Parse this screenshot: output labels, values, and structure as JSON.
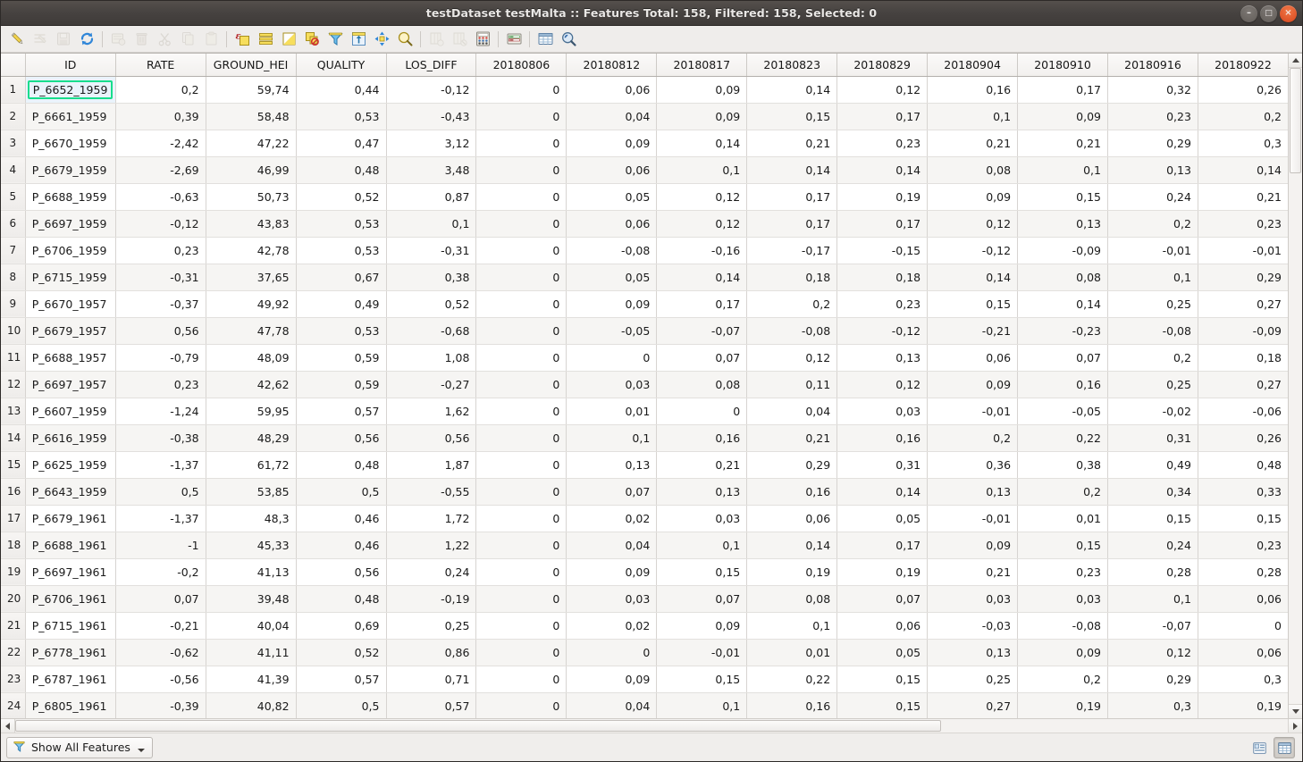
{
  "window": {
    "title": "testDataset testMalta :: Features Total: 158, Filtered: 158, Selected: 0",
    "minimize_label": "–",
    "maximize_label": "□",
    "close_label": "×"
  },
  "toolbar": {
    "items": [
      {
        "name": "toggle-editing-icon",
        "label": "Toggle editing mode",
        "enabled": true
      },
      {
        "name": "multi-edit-icon",
        "label": "Toggle multi edit mode",
        "enabled": false
      },
      {
        "name": "save-edits-icon",
        "label": "Save edits",
        "enabled": false
      },
      {
        "name": "reload-table-icon",
        "label": "Reload the table",
        "enabled": true
      },
      {
        "name": "add-feature-icon",
        "label": "Add feature",
        "enabled": false
      },
      {
        "name": "delete-selected-icon",
        "label": "Delete selected features",
        "enabled": false
      },
      {
        "name": "cut-features-icon",
        "label": "Cut selected features",
        "enabled": false
      },
      {
        "name": "copy-features-icon",
        "label": "Copy selected features",
        "enabled": false
      },
      {
        "name": "paste-features-icon",
        "label": "Paste features",
        "enabled": false
      },
      {
        "name": "select-by-expression-icon",
        "label": "Select features using an expression",
        "enabled": true
      },
      {
        "name": "select-all-icon",
        "label": "Select all",
        "enabled": true
      },
      {
        "name": "invert-selection-icon",
        "label": "Invert selection",
        "enabled": true
      },
      {
        "name": "deselect-all-icon",
        "label": "Deselect all",
        "enabled": true
      },
      {
        "name": "filter-selection-icon",
        "label": "Filter / select features",
        "enabled": true
      },
      {
        "name": "move-selection-top-icon",
        "label": "Move selection to top",
        "enabled": true
      },
      {
        "name": "pan-to-selection-icon",
        "label": "Pan map to selected rows",
        "enabled": true
      },
      {
        "name": "zoom-to-selection-icon",
        "label": "Zoom map to selected rows",
        "enabled": true
      },
      {
        "name": "new-field-icon",
        "label": "New field",
        "enabled": false
      },
      {
        "name": "delete-field-icon",
        "label": "Delete field",
        "enabled": false
      },
      {
        "name": "open-field-calculator-icon",
        "label": "Open field calculator",
        "enabled": true
      },
      {
        "name": "conditional-formatting-icon",
        "label": "Conditional formatting",
        "enabled": true
      },
      {
        "name": "organize-columns-icon",
        "label": "Organize columns",
        "enabled": true
      },
      {
        "name": "actions-icon",
        "label": "Actions",
        "enabled": true
      }
    ]
  },
  "table": {
    "columns": [
      "ID",
      "RATE",
      "GROUND_HEI",
      "QUALITY",
      "LOS_DIFF",
      "20180806",
      "20180812",
      "20180817",
      "20180823",
      "20180829",
      "20180904",
      "20180910",
      "20180916",
      "20180922"
    ],
    "selected_cell": {
      "row": 1,
      "column": "ID",
      "highlight_color": "#18dd8c"
    },
    "rows": [
      {
        "n": "1",
        "cells": [
          "P_6652_1959",
          "0,2",
          "59,74",
          "0,44",
          "-0,12",
          "0",
          "0,06",
          "0,09",
          "0,14",
          "0,12",
          "0,16",
          "0,17",
          "0,32",
          "0,26"
        ]
      },
      {
        "n": "2",
        "cells": [
          "P_6661_1959",
          "0,39",
          "58,48",
          "0,53",
          "-0,43",
          "0",
          "0,04",
          "0,09",
          "0,15",
          "0,17",
          "0,1",
          "0,09",
          "0,23",
          "0,2"
        ]
      },
      {
        "n": "3",
        "cells": [
          "P_6670_1959",
          "-2,42",
          "47,22",
          "0,47",
          "3,12",
          "0",
          "0,09",
          "0,14",
          "0,21",
          "0,23",
          "0,21",
          "0,21",
          "0,29",
          "0,3"
        ]
      },
      {
        "n": "4",
        "cells": [
          "P_6679_1959",
          "-2,69",
          "46,99",
          "0,48",
          "3,48",
          "0",
          "0,06",
          "0,1",
          "0,14",
          "0,14",
          "0,08",
          "0,1",
          "0,13",
          "0,14"
        ]
      },
      {
        "n": "5",
        "cells": [
          "P_6688_1959",
          "-0,63",
          "50,73",
          "0,52",
          "0,87",
          "0",
          "0,05",
          "0,12",
          "0,17",
          "0,19",
          "0,09",
          "0,15",
          "0,24",
          "0,21"
        ]
      },
      {
        "n": "6",
        "cells": [
          "P_6697_1959",
          "-0,12",
          "43,83",
          "0,53",
          "0,1",
          "0",
          "0,06",
          "0,12",
          "0,17",
          "0,17",
          "0,12",
          "0,13",
          "0,2",
          "0,23"
        ]
      },
      {
        "n": "7",
        "cells": [
          "P_6706_1959",
          "0,23",
          "42,78",
          "0,53",
          "-0,31",
          "0",
          "-0,08",
          "-0,16",
          "-0,17",
          "-0,15",
          "-0,12",
          "-0,09",
          "-0,01",
          "-0,01"
        ]
      },
      {
        "n": "8",
        "cells": [
          "P_6715_1959",
          "-0,31",
          "37,65",
          "0,67",
          "0,38",
          "0",
          "0,05",
          "0,14",
          "0,18",
          "0,18",
          "0,14",
          "0,08",
          "0,1",
          "0,29"
        ]
      },
      {
        "n": "9",
        "cells": [
          "P_6670_1957",
          "-0,37",
          "49,92",
          "0,49",
          "0,52",
          "0",
          "0,09",
          "0,17",
          "0,2",
          "0,23",
          "0,15",
          "0,14",
          "0,25",
          "0,27"
        ]
      },
      {
        "n": "10",
        "cells": [
          "P_6679_1957",
          "0,56",
          "47,78",
          "0,53",
          "-0,68",
          "0",
          "-0,05",
          "-0,07",
          "-0,08",
          "-0,12",
          "-0,21",
          "-0,23",
          "-0,08",
          "-0,09"
        ]
      },
      {
        "n": "11",
        "cells": [
          "P_6688_1957",
          "-0,79",
          "48,09",
          "0,59",
          "1,08",
          "0",
          "0",
          "0,07",
          "0,12",
          "0,13",
          "0,06",
          "0,07",
          "0,2",
          "0,18"
        ]
      },
      {
        "n": "12",
        "cells": [
          "P_6697_1957",
          "0,23",
          "42,62",
          "0,59",
          "-0,27",
          "0",
          "0,03",
          "0,08",
          "0,11",
          "0,12",
          "0,09",
          "0,16",
          "0,25",
          "0,27"
        ]
      },
      {
        "n": "13",
        "cells": [
          "P_6607_1959",
          "-1,24",
          "59,95",
          "0,57",
          "1,62",
          "0",
          "0,01",
          "0",
          "0,04",
          "0,03",
          "-0,01",
          "-0,05",
          "-0,02",
          "-0,06"
        ]
      },
      {
        "n": "14",
        "cells": [
          "P_6616_1959",
          "-0,38",
          "48,29",
          "0,56",
          "0,56",
          "0",
          "0,1",
          "0,16",
          "0,21",
          "0,16",
          "0,2",
          "0,22",
          "0,31",
          "0,26"
        ]
      },
      {
        "n": "15",
        "cells": [
          "P_6625_1959",
          "-1,37",
          "61,72",
          "0,48",
          "1,87",
          "0",
          "0,13",
          "0,21",
          "0,29",
          "0,31",
          "0,36",
          "0,38",
          "0,49",
          "0,48"
        ]
      },
      {
        "n": "16",
        "cells": [
          "P_6643_1959",
          "0,5",
          "53,85",
          "0,5",
          "-0,55",
          "0",
          "0,07",
          "0,13",
          "0,16",
          "0,14",
          "0,13",
          "0,2",
          "0,34",
          "0,33"
        ]
      },
      {
        "n": "17",
        "cells": [
          "P_6679_1961",
          "-1,37",
          "48,3",
          "0,46",
          "1,72",
          "0",
          "0,02",
          "0,03",
          "0,06",
          "0,05",
          "-0,01",
          "0,01",
          "0,15",
          "0,15"
        ]
      },
      {
        "n": "18",
        "cells": [
          "P_6688_1961",
          "-1",
          "45,33",
          "0,46",
          "1,22",
          "0",
          "0,04",
          "0,1",
          "0,14",
          "0,17",
          "0,09",
          "0,15",
          "0,24",
          "0,23"
        ]
      },
      {
        "n": "19",
        "cells": [
          "P_6697_1961",
          "-0,2",
          "41,13",
          "0,56",
          "0,24",
          "0",
          "0,09",
          "0,15",
          "0,19",
          "0,19",
          "0,21",
          "0,23",
          "0,28",
          "0,28"
        ]
      },
      {
        "n": "20",
        "cells": [
          "P_6706_1961",
          "0,07",
          "39,48",
          "0,48",
          "-0,19",
          "0",
          "0,03",
          "0,07",
          "0,08",
          "0,07",
          "0,03",
          "0,03",
          "0,1",
          "0,06"
        ]
      },
      {
        "n": "21",
        "cells": [
          "P_6715_1961",
          "-0,21",
          "40,04",
          "0,69",
          "0,25",
          "0",
          "0,02",
          "0,09",
          "0,1",
          "0,06",
          "-0,03",
          "-0,08",
          "-0,07",
          "0"
        ]
      },
      {
        "n": "22",
        "cells": [
          "P_6778_1961",
          "-0,62",
          "41,11",
          "0,52",
          "0,86",
          "0",
          "0",
          "-0,01",
          "0,01",
          "0,05",
          "0,13",
          "0,09",
          "0,12",
          "0,06"
        ]
      },
      {
        "n": "23",
        "cells": [
          "P_6787_1961",
          "-0,56",
          "41,39",
          "0,57",
          "0,71",
          "0",
          "0,09",
          "0,15",
          "0,22",
          "0,15",
          "0,25",
          "0,2",
          "0,29",
          "0,3"
        ]
      },
      {
        "n": "24",
        "cells": [
          "P_6805_1961",
          "-0,39",
          "40,82",
          "0,5",
          "0,57",
          "0",
          "0,04",
          "0,1",
          "0,16",
          "0,15",
          "0,27",
          "0,19",
          "0,3",
          "0,19"
        ]
      }
    ]
  },
  "statusbar": {
    "filter_label": "Show All Features",
    "filter_icon": "funnel-icon",
    "view_form_label": "Switch to form view",
    "view_table_label": "Switch to table view",
    "active_view": "table"
  }
}
